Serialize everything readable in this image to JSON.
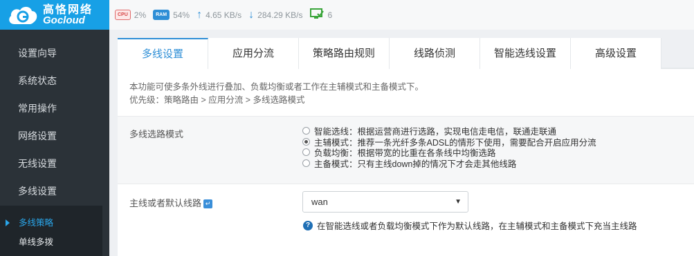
{
  "brand": {
    "name_cn": "高恪网络",
    "name_en": "Gocloud"
  },
  "sidebar": {
    "items": [
      {
        "label": "设置向导"
      },
      {
        "label": "系统状态"
      },
      {
        "label": "常用操作"
      },
      {
        "label": "网络设置"
      },
      {
        "label": "无线设置"
      },
      {
        "label": "多线设置"
      }
    ],
    "subitems": [
      {
        "label": "多线策略",
        "active": true
      },
      {
        "label": "单线多拨"
      }
    ]
  },
  "topbar": {
    "cpu_label": "CPU",
    "cpu_value": "2%",
    "ram_label": "RAM",
    "ram_value": "54%",
    "upload": "4.65 KB/s",
    "download": "284.29 KB/s",
    "online": "6"
  },
  "tabs": [
    {
      "label": "多线设置",
      "active": true
    },
    {
      "label": "应用分流"
    },
    {
      "label": "策略路由规则"
    },
    {
      "label": "线路侦测"
    },
    {
      "label": "智能选线设置"
    },
    {
      "label": "高级设置"
    }
  ],
  "description": {
    "line1": "本功能可使多条外线进行叠加、负载均衡或者工作在主辅模式和主备模式下。",
    "line2": "优先级：策略路由 > 应用分流 > 多线选路模式"
  },
  "mode": {
    "label": "多线选路模式",
    "options": [
      {
        "text": "智能选线：根据运营商进行选路，实现电信走电信，联通走联通",
        "selected": false
      },
      {
        "text": "主辅模式：推荐一条光纤多条ADSL的情形下使用，需要配合开启应用分流",
        "selected": true
      },
      {
        "text": "负载均衡：根据带宽的比重在各条线中均衡选路",
        "selected": false
      },
      {
        "text": "主备模式：只有主线down掉的情况下才会走其他线路",
        "selected": false
      }
    ]
  },
  "default_line": {
    "label": "主线或者默认线路",
    "value": "wan",
    "help": "在智能选线或者负载均衡模式下作为默认线路，在主辅模式和主备模式下充当主线路"
  }
}
